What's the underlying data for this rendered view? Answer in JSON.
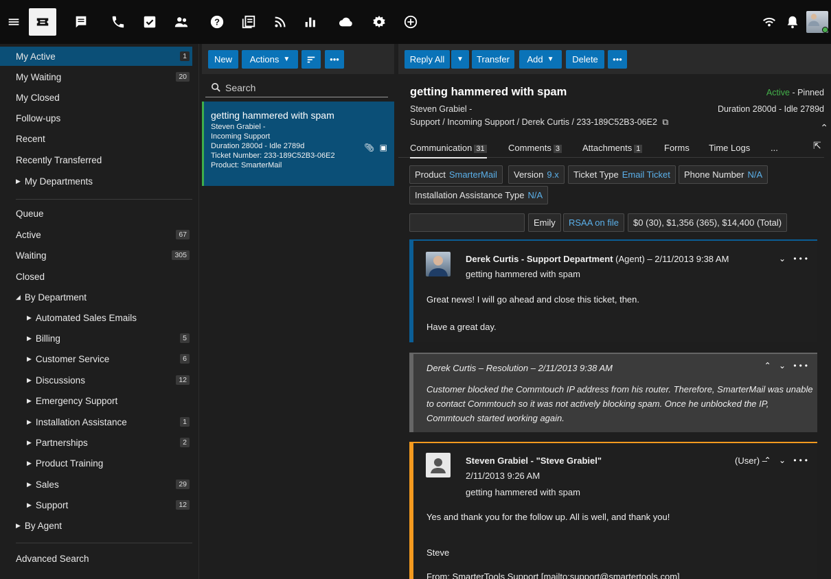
{
  "topbar": {
    "icons": [
      "menu-icon",
      "tickets-icon",
      "chat-icon",
      "phone-icon",
      "tasks-icon",
      "users-icon",
      "help-icon",
      "knowledge-base-icon",
      "rss-icon",
      "reports-icon",
      "cloud-icon",
      "settings-icon",
      "add-icon"
    ],
    "right_icons": [
      "wifi-icon",
      "bell-icon"
    ]
  },
  "sidebar": {
    "top": [
      {
        "label": "My Active",
        "count": "1"
      },
      {
        "label": "My Waiting",
        "count": "20"
      },
      {
        "label": "My Closed",
        "count": ""
      },
      {
        "label": "Follow-ups",
        "count": ""
      },
      {
        "label": "Recent",
        "count": ""
      },
      {
        "label": "Recently Transferred",
        "count": ""
      },
      {
        "label": "My Departments",
        "count": ""
      }
    ],
    "queue": [
      {
        "label": "Queue",
        "count": ""
      },
      {
        "label": "Active",
        "count": "67"
      },
      {
        "label": "Waiting",
        "count": "305"
      },
      {
        "label": "Closed",
        "count": ""
      },
      {
        "label": "By Department",
        "count": ""
      }
    ],
    "departments": [
      {
        "label": "Automated Sales Emails",
        "count": ""
      },
      {
        "label": "Billing",
        "count": "5"
      },
      {
        "label": "Customer Service",
        "count": "6"
      },
      {
        "label": "Discussions",
        "count": "12"
      },
      {
        "label": "Emergency Support",
        "count": ""
      },
      {
        "label": "Installation Assistance",
        "count": "1"
      },
      {
        "label": "Partnerships",
        "count": "2"
      },
      {
        "label": "Product Training",
        "count": ""
      },
      {
        "label": "Sales",
        "count": "29"
      },
      {
        "label": "Support",
        "count": "12"
      }
    ],
    "by_agent": "By Agent",
    "advanced_search": "Advanced Search"
  },
  "middle": {
    "new_label": "New",
    "actions_label": "Actions",
    "search_placeholder": "Search",
    "ticket": {
      "title": "getting hammered with spam",
      "customer": "Steven Grabiel -",
      "department": "Incoming Support",
      "duration": "Duration 2800d  -  Idle 2789d",
      "number": "Ticket Number: 233-189C52B3-06E2",
      "product": "Product: SmarterMail"
    }
  },
  "right": {
    "toolbar": {
      "reply_all": "Reply All",
      "transfer": "Transfer",
      "add": "Add",
      "delete": "Delete"
    },
    "title": "getting hammered with spam",
    "customer": "Steven Grabiel -",
    "status_active": "Active",
    "status_rest": " - Pinned",
    "duration": "Duration 2800d  -  Idle 2789d",
    "path": "Support / Incoming Support / Derek Curtis / 233-189C52B3-06E2",
    "tabs": [
      {
        "label": "Communication",
        "count": "31"
      },
      {
        "label": "Comments",
        "count": "3"
      },
      {
        "label": "Attachments",
        "count": "1"
      },
      {
        "label": "Forms",
        "count": ""
      },
      {
        "label": "Time Logs",
        "count": ""
      },
      {
        "label": "...",
        "count": ""
      }
    ],
    "fields": [
      {
        "label": "Product",
        "value": "SmarterMail"
      },
      {
        "label": "Version",
        "value": "9.x"
      },
      {
        "label": "Ticket Type",
        "value": "Email Ticket"
      },
      {
        "label": "Phone Number",
        "value": "N/A"
      },
      {
        "label": "Installation Assistance Type",
        "value": "N/A"
      }
    ],
    "chips2": {
      "name": "Emily",
      "rsaa": "RSAA on file",
      "totals": "$0 (30), $1,356 (365), $14,400 (Total)"
    },
    "messages": [
      {
        "from": "Derek Curtis - Support Department",
        "meta": " (Agent) – 2/11/2013 9:38 AM",
        "subject": "getting hammered with spam",
        "line1": "Great news! I will go ahead and close this ticket, then.",
        "line2": "Have a great day."
      },
      {
        "header": "Derek Curtis – Resolution – 2/11/2013 9:38 AM",
        "text1": "Customer blocked the Commtouch IP address from his router. Therefore, SmarterMail was unable",
        "text2": "to contact Commtouch so it was not actively blocking spam. Once he unblocked the IP,",
        "text3": "Commtouch started working again."
      },
      {
        "from": "Steven Grabiel - \"Steve Grabiel\"",
        "role": "(User) –",
        "date": "2/11/2013 9:26 AM",
        "subject": "getting hammered with spam",
        "line1": "Yes and thank you for the follow up. All is well, and thank you!",
        "line2": "Steve",
        "line3": "From: SmarterTools Support [mailto:support@smartertools.com]"
      }
    ]
  }
}
